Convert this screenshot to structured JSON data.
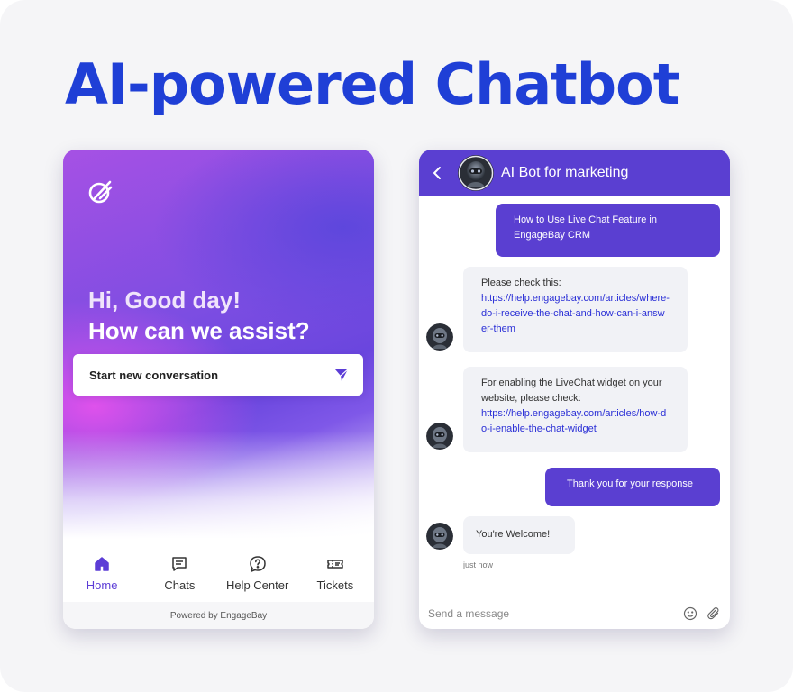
{
  "page": {
    "title": "AI-powered Chatbot"
  },
  "widget": {
    "greeting_line1": "Hi, Good day!",
    "greeting_line2": "How can we assist?",
    "start_label": "Start new conversation",
    "nav": [
      {
        "label": "Home",
        "icon": "home-icon",
        "active": true
      },
      {
        "label": "Chats",
        "icon": "chat-icon",
        "active": false
      },
      {
        "label": "Help Center",
        "icon": "help-icon",
        "active": false
      },
      {
        "label": "Tickets",
        "icon": "ticket-icon",
        "active": false
      }
    ],
    "footer": "Powered by EngageBay",
    "accent": "#5c3dd6"
  },
  "chat": {
    "bot_name": "AI Bot for marketing",
    "header_color": "#5a3fd1",
    "messages": [
      {
        "from": "user",
        "text": "How to Use Live Chat Feature in EngageBay CRM"
      },
      {
        "from": "bot",
        "text": "Please check this:",
        "link": "https://help.engagebay.com/articles/where-do-i-receive-the-chat-and-how-can-i-answer-them"
      },
      {
        "from": "bot",
        "text": "For enabling the LiveChat widget on your website, please check:",
        "link": "https://help.engagebay.com/articles/how-do-i-enable-the-chat-widget"
      },
      {
        "from": "user",
        "text": "Thank you for your response"
      },
      {
        "from": "bot",
        "text": "You're Welcome!"
      }
    ],
    "last_time": "just now",
    "composer_placeholder": "Send a message"
  }
}
